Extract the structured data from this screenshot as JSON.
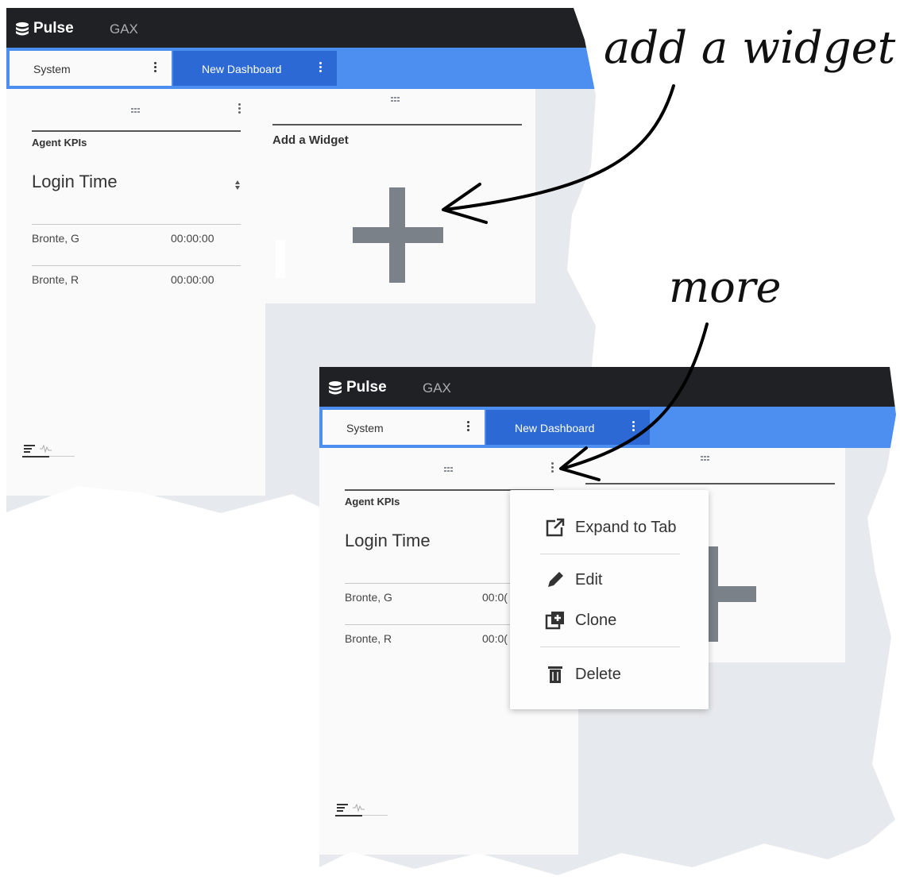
{
  "app": {
    "brand": "Pulse",
    "secondary_link": "GAX"
  },
  "tabs": [
    {
      "label": "System"
    },
    {
      "label": "New Dashboard"
    }
  ],
  "widget": {
    "title": "Agent KPIs",
    "metric": "Login Time",
    "rows": [
      {
        "name": "Bronte, G",
        "value": "00:00:00"
      },
      {
        "name": "Bronte, R",
        "value": "00:00:00"
      }
    ],
    "rows_truncated": [
      {
        "name": "Bronte, G",
        "value": "00:0("
      },
      {
        "name": "Bronte, R",
        "value": "00:0("
      }
    ]
  },
  "add_widget": {
    "title": "Add a Widget"
  },
  "menu": {
    "items": [
      {
        "label": "Expand to Tab",
        "icon": "open-in-new-icon"
      },
      {
        "label": "Edit",
        "icon": "pencil-icon"
      },
      {
        "label": "Clone",
        "icon": "clone-icon"
      },
      {
        "label": "Delete",
        "icon": "trash-icon"
      }
    ]
  },
  "annotations": {
    "top": "add a widget",
    "middle": "more"
  },
  "colors": {
    "topbar": "#1f2124",
    "tabbar": "#4d8ff0",
    "active_tab": "#2c69d4",
    "panel": "#fafafa",
    "plus": "#7a8188"
  }
}
